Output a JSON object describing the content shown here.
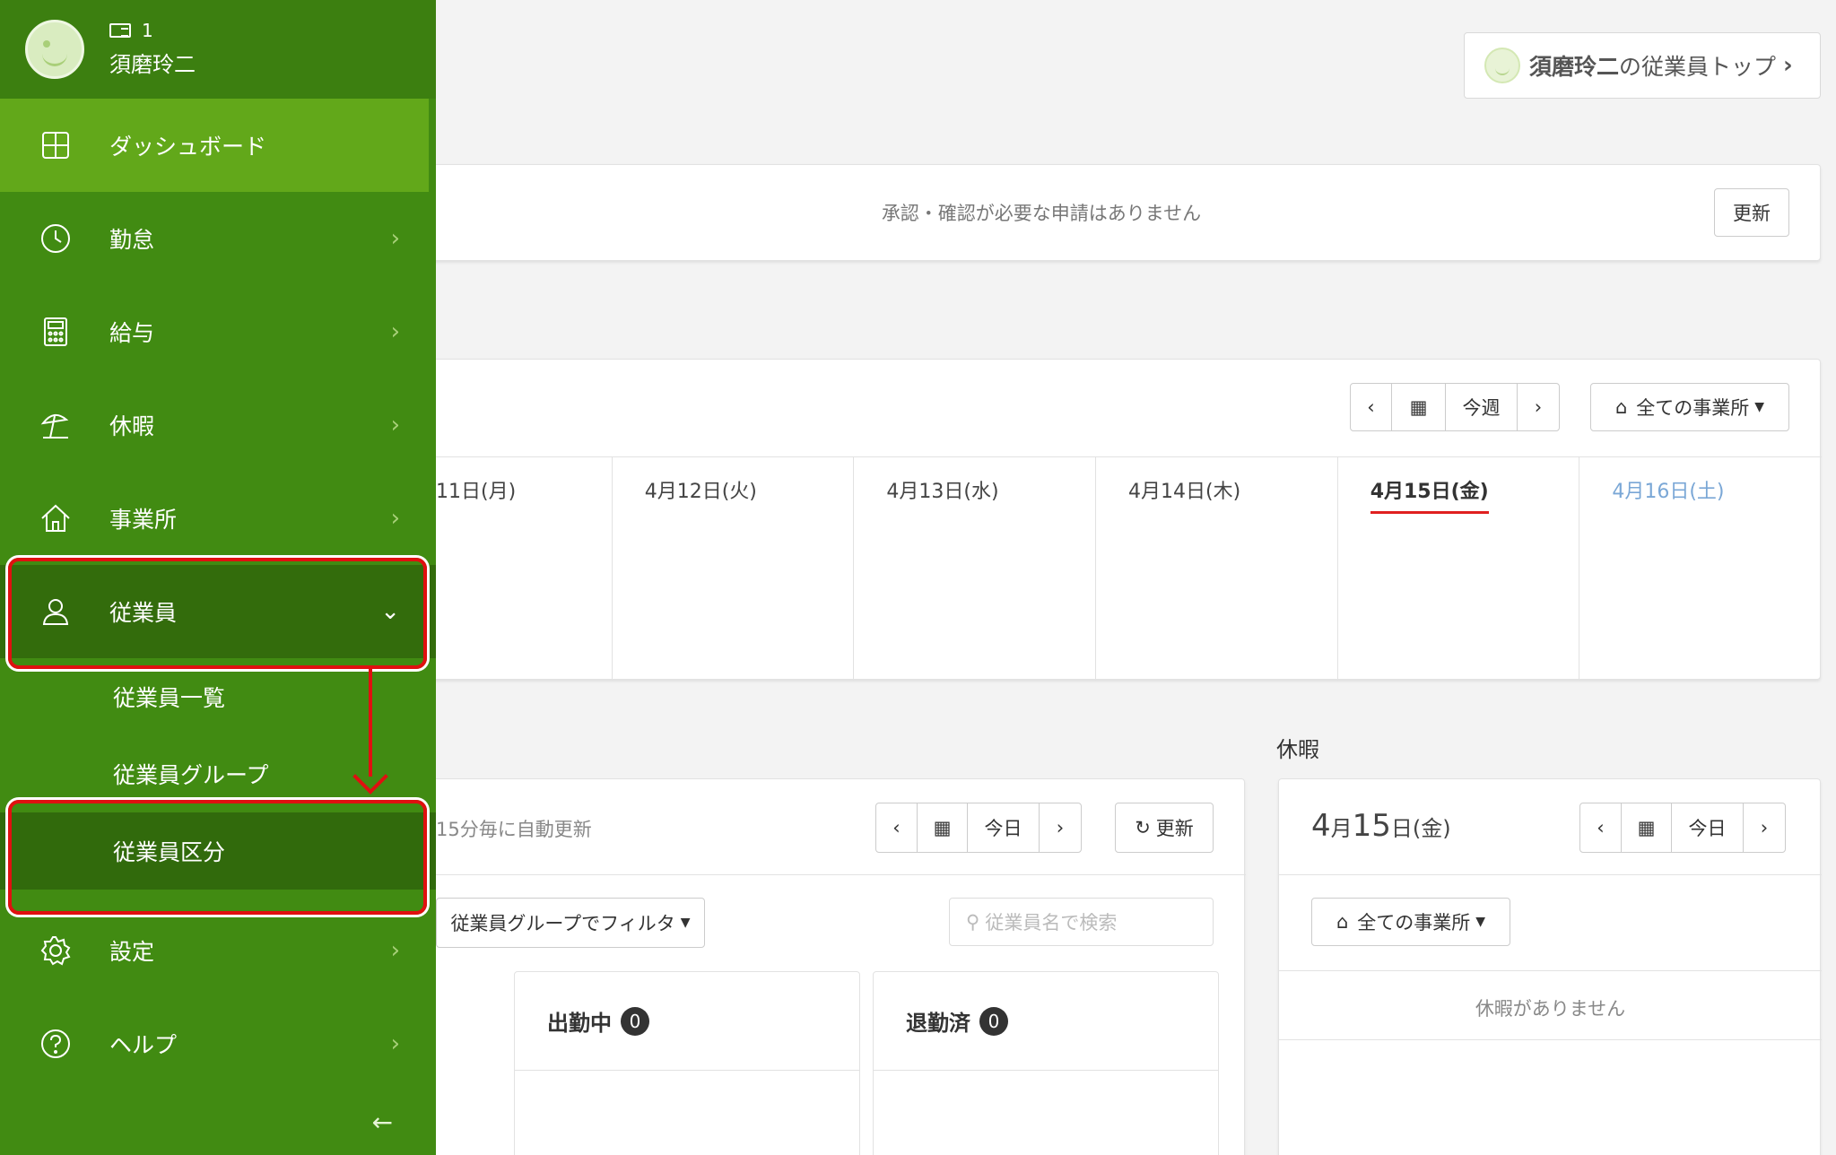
{
  "user": {
    "id_label": "1",
    "name": "須磨玲二"
  },
  "sidebar": {
    "items": [
      {
        "label": "ダッシュボード",
        "icon": "dashboard-icon"
      },
      {
        "label": "勤怠",
        "icon": "clock-icon"
      },
      {
        "label": "給与",
        "icon": "calculator-icon"
      },
      {
        "label": "休暇",
        "icon": "beach-umbrella-icon"
      },
      {
        "label": "事業所",
        "icon": "home-icon"
      },
      {
        "label": "従業員",
        "icon": "person-icon"
      },
      {
        "label": "設定",
        "icon": "gear-icon"
      },
      {
        "label": "ヘルプ",
        "icon": "help-icon"
      }
    ],
    "employee_sub": [
      "従業員一覧",
      "従業員グループ",
      "従業員区分"
    ],
    "collapse_icon": "arrow-left-icon"
  },
  "top_button": {
    "name": "須磨玲二",
    "suffix": "の従業員トップ"
  },
  "approval": {
    "message": "承認・確認が必要な申請はありません",
    "refresh_label": "更新"
  },
  "week": {
    "this_week_label": "今週",
    "office_label": "全ての事業所",
    "days": [
      "11日(月)",
      "4月12日(火)",
      "4月13日(水)",
      "4月14日(木)",
      "4月15日(金)",
      "4月16日(土)"
    ]
  },
  "vacation_title": "休暇",
  "attendance": {
    "auto_refresh_note": "15分毎に自動更新",
    "today_label": "今日",
    "refresh_label": "更新",
    "filter_label": "従業員グループでフィルタ",
    "search_placeholder": "従業員名で検索",
    "columns": [
      {
        "label": "出勤中",
        "count": "0"
      },
      {
        "label": "退勤済",
        "count": "0"
      }
    ]
  },
  "vacation": {
    "month": "4",
    "month_unit": "月",
    "day": "15",
    "day_unit": "日(金)",
    "today_label": "今日",
    "office_label": "全ての事業所",
    "empty_message": "休暇がありません"
  },
  "colors": {
    "sidebar_green": "#418b12",
    "active_green": "#62a81a",
    "annotation_red": "#e01010"
  }
}
